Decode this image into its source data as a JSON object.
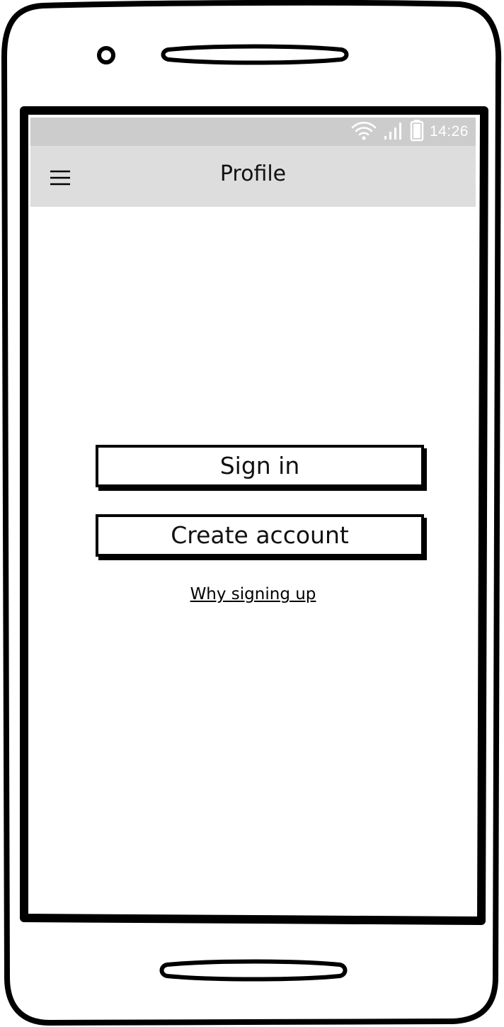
{
  "status_bar": {
    "time": "14:26",
    "wifi_icon": "wifi-icon",
    "signal_icon": "signal-icon",
    "battery_icon": "battery-icon"
  },
  "app_bar": {
    "title": "Profile",
    "menu_icon": "hamburger-menu-icon"
  },
  "main": {
    "sign_in_label": "Sign in",
    "create_account_label": "Create account",
    "why_link": "Why signing up"
  },
  "colors": {
    "status_bar_bg": "#cccccc",
    "app_bar_bg": "#dddddd",
    "border": "#000000"
  }
}
